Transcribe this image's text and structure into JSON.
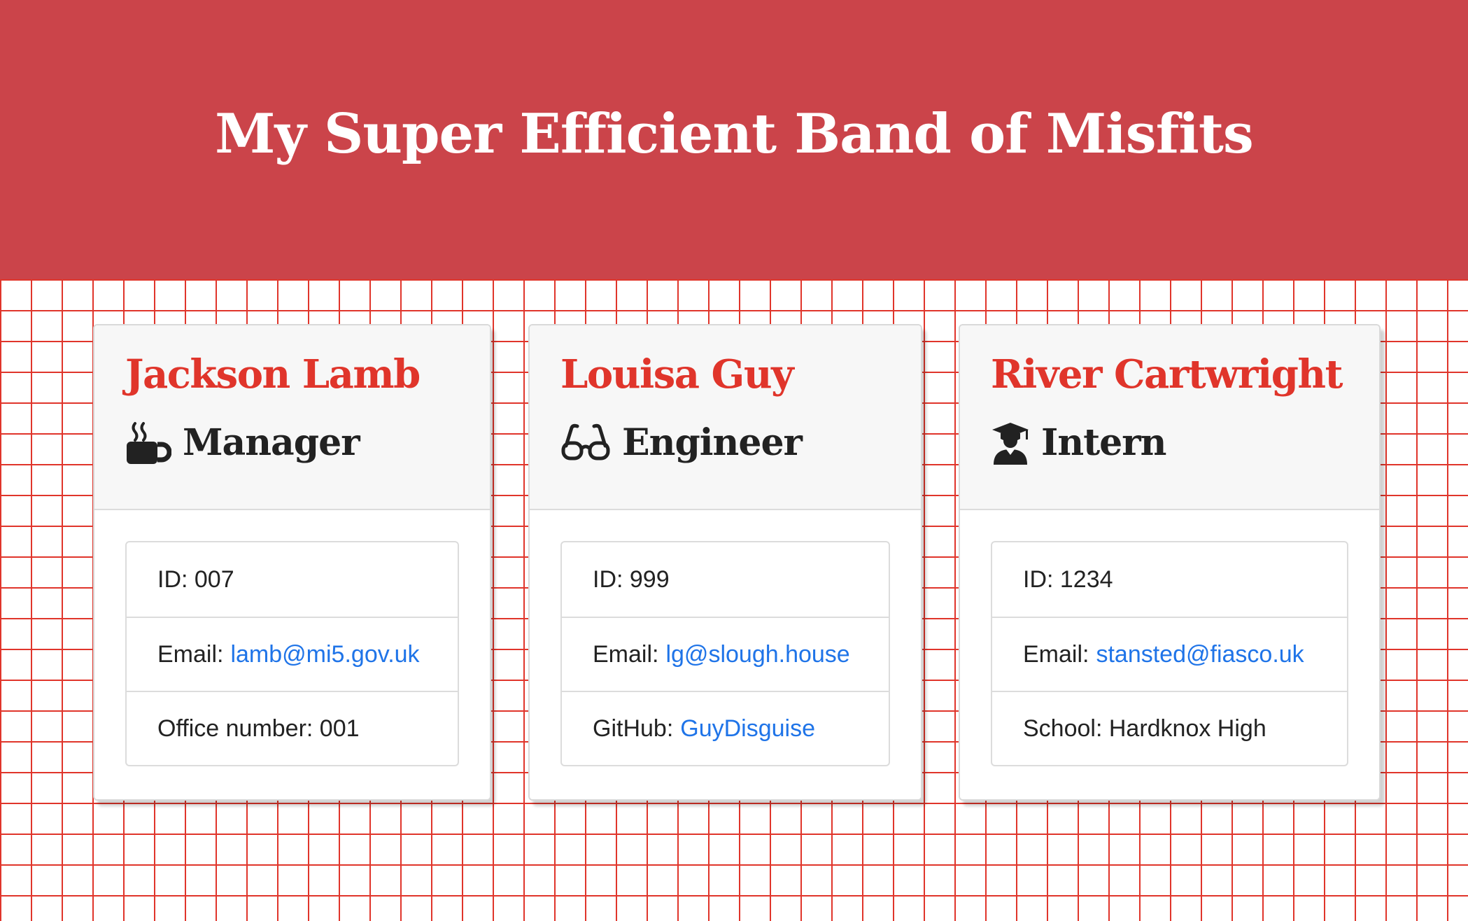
{
  "header": {
    "title": "My Super Efficient Band of Misfits"
  },
  "colors": {
    "banner": "#cb444a",
    "name": "#e0352b",
    "grid": "#e0352b",
    "link": "#1f74e8"
  },
  "employees": [
    {
      "name": "Jackson Lamb",
      "role": "Manager",
      "role_icon": "coffee-mug-icon",
      "id_text": "ID: 007",
      "email_label": "Email:",
      "email": "lamb@mi5.gov.uk",
      "extra_label": "Office number: 001"
    },
    {
      "name": "Louisa Guy",
      "role": "Engineer",
      "role_icon": "glasses-icon",
      "id_text": "ID: 999",
      "email_label": "Email:",
      "email": "lg@slough.house",
      "extra_label": "GitHub:",
      "extra_link": "GuyDisguise"
    },
    {
      "name": "River Cartwright",
      "role": "Intern",
      "role_icon": "graduate-icon",
      "id_text": "ID: 1234",
      "email_label": "Email:",
      "email": "stansted@fiasco.uk",
      "extra_label": "School: Hardknox High"
    }
  ]
}
